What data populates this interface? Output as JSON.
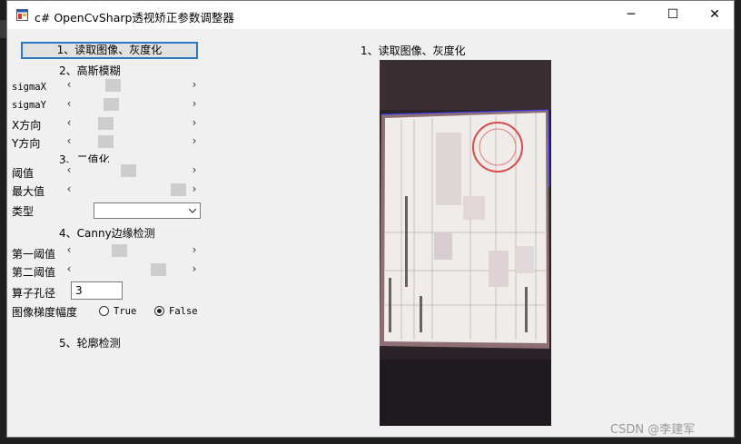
{
  "window": {
    "title": "c# OpenCvSharp透视矫正参数调整器",
    "minimize_glyph": "─",
    "maximize_glyph": "☐",
    "close_glyph": "✕"
  },
  "sections": {
    "s1_button": "1、读取图像、灰度化",
    "s2": "2、高斯模糊",
    "s3": "3、二值化",
    "s4": "4、Canny边缘检测",
    "s5": "5、轮廓检测"
  },
  "labels": {
    "sigmaX": "sigmaX",
    "sigmaY": "sigmaY",
    "x_dir": "X方向",
    "y_dir": "Y方向",
    "threshold": "阈值",
    "max_value": "最大值",
    "type": "类型",
    "first_threshold": "第一阈值",
    "second_threshold": "第二阈值",
    "aperture": "算子孔径",
    "gradient": "图像梯度幅度",
    "true_opt": "True",
    "false_opt": "False"
  },
  "values": {
    "aperture": "3",
    "type_selected": "",
    "sliders": {
      "sigmaX": 0.4,
      "sigmaY": 0.38,
      "x_dir": 0.3,
      "y_dir": 0.3,
      "threshold": 0.5,
      "max_value": 0.95,
      "first_threshold": 0.45,
      "second_threshold": 0.78
    },
    "gradient_selected": "False"
  },
  "image_panel": {
    "title": "1、读取图像、灰度化"
  },
  "watermark": "CSDN @李建军",
  "icons": {
    "app": "app-window-icon",
    "combo": "chevron-down-icon"
  }
}
